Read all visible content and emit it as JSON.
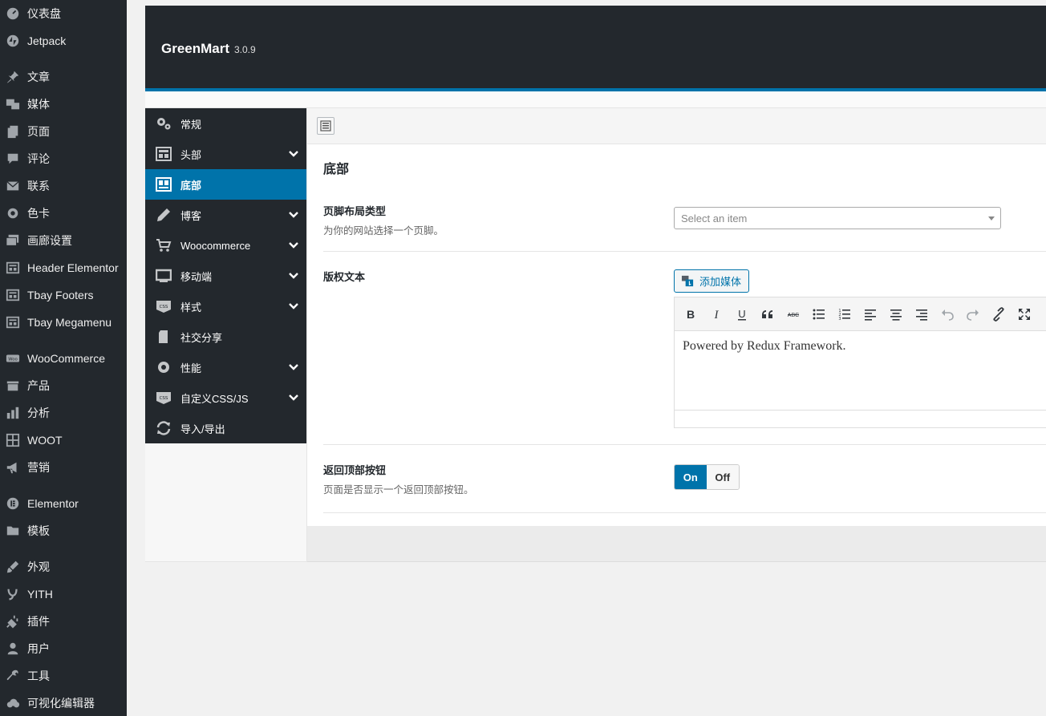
{
  "admin_menu": [
    {
      "label": "仪表盘",
      "icon": "dashboard-icon"
    },
    {
      "label": "Jetpack",
      "icon": "jetpack-icon"
    },
    {
      "label": "文章",
      "icon": "pin-icon"
    },
    {
      "label": "媒体",
      "icon": "media-icon"
    },
    {
      "label": "页面",
      "icon": "page-icon"
    },
    {
      "label": "评论",
      "icon": "comment-icon"
    },
    {
      "label": "联系",
      "icon": "mail-icon"
    },
    {
      "label": "色卡",
      "icon": "gear-icon"
    },
    {
      "label": "画廊设置",
      "icon": "gallery-icon"
    },
    {
      "label": "Header Elementor",
      "icon": "layout-icon"
    },
    {
      "label": "Tbay Footers",
      "icon": "layout-icon"
    },
    {
      "label": "Tbay Megamenu",
      "icon": "layout-icon"
    },
    {
      "label": "WooCommerce",
      "icon": "woo-icon"
    },
    {
      "label": "产品",
      "icon": "archive-icon"
    },
    {
      "label": "分析",
      "icon": "chart-icon"
    },
    {
      "label": "WOOT",
      "icon": "grid-icon"
    },
    {
      "label": "营销",
      "icon": "megaphone-icon"
    },
    {
      "label": "Elementor",
      "icon": "elementor-icon"
    },
    {
      "label": "模板",
      "icon": "folder-icon"
    },
    {
      "label": "外观",
      "icon": "brush-icon"
    },
    {
      "label": "YITH",
      "icon": "yith-icon"
    },
    {
      "label": "插件",
      "icon": "plugin-icon"
    },
    {
      "label": "用户",
      "icon": "user-icon"
    },
    {
      "label": "工具",
      "icon": "wrench-icon"
    },
    {
      "label": "可视化编辑器",
      "icon": "cloud-icon"
    }
  ],
  "header": {
    "title": "GreenMart",
    "version": "3.0.9"
  },
  "options_menu": [
    {
      "label": "常规",
      "icon": "gears-icon",
      "has_sub": false
    },
    {
      "label": "头部",
      "icon": "header-layout-icon",
      "has_sub": true
    },
    {
      "label": "底部",
      "icon": "footer-layout-icon",
      "has_sub": false,
      "active": true
    },
    {
      "label": "博客",
      "icon": "pencil-icon",
      "has_sub": true
    },
    {
      "label": "Woocommerce",
      "icon": "cart-icon",
      "has_sub": true
    },
    {
      "label": "移动端",
      "icon": "monitor-icon",
      "has_sub": true
    },
    {
      "label": "样式",
      "icon": "css-icon",
      "has_sub": true
    },
    {
      "label": "社交分享",
      "icon": "document-icon",
      "has_sub": false
    },
    {
      "label": "性能",
      "icon": "cog-icon",
      "has_sub": true
    },
    {
      "label": "自定义CSS/JS",
      "icon": "css-icon",
      "has_sub": true
    },
    {
      "label": "导入/导出",
      "icon": "refresh-icon",
      "has_sub": false
    }
  ],
  "section": {
    "title": "底部",
    "fields": {
      "layout": {
        "title": "页脚布局类型",
        "desc": "为你的网站选择一个页脚。",
        "placeholder": "Select an item"
      },
      "copyright": {
        "title": "版权文本",
        "add_media_label": "添加媒体",
        "content": "Powered by Redux Framework."
      },
      "back_to_top": {
        "title": "返回顶部按钮",
        "desc": "页面是否显示一个返回顶部按钮。",
        "on_label": "On",
        "off_label": "Off",
        "value": "On"
      }
    }
  },
  "editor_toolbar": [
    "bold-icon",
    "italic-icon",
    "underline-icon",
    "blockquote-icon",
    "strikethrough-icon",
    "bullet-list-icon",
    "numbered-list-icon",
    "align-left-icon",
    "align-center-icon",
    "align-right-icon",
    "undo-icon",
    "redo-icon",
    "link-icon",
    "fullscreen-icon"
  ],
  "colors": {
    "accent": "#0073aa",
    "sidebar_bg": "#23282d"
  }
}
